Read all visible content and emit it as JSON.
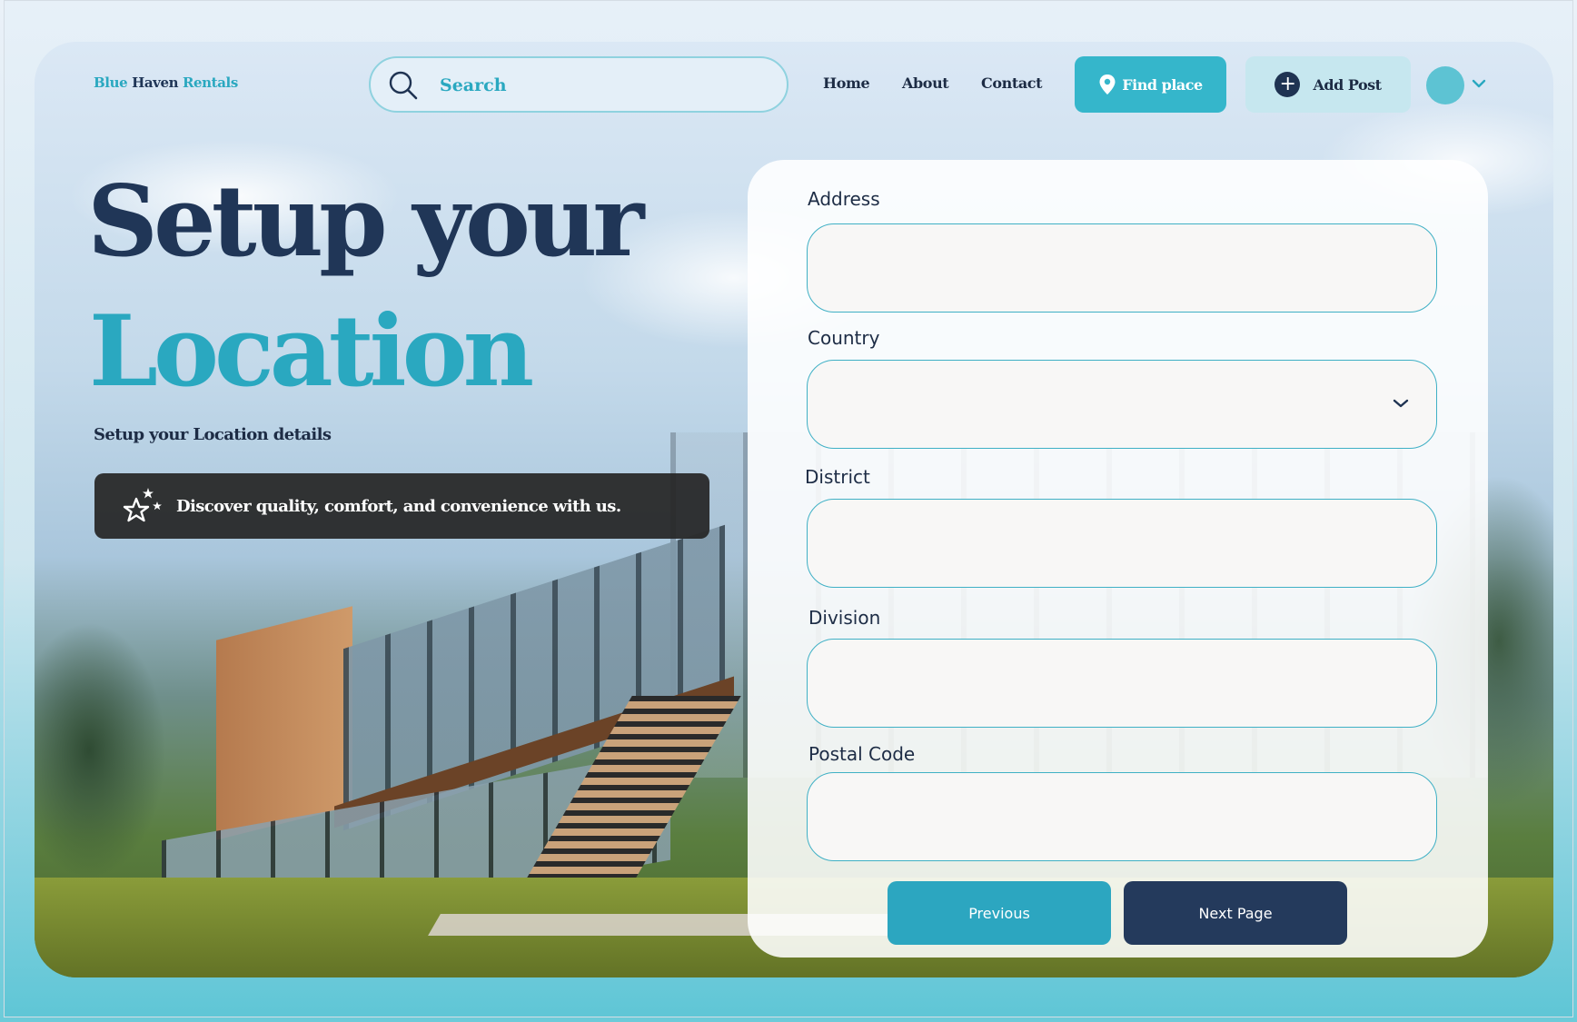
{
  "brand": {
    "part1": "Blue",
    "part2": "Haven",
    "part3": "Rentals"
  },
  "search": {
    "placeholder": "Search",
    "icon": "search-icon"
  },
  "nav": {
    "items": [
      "Home",
      "About",
      "Contact"
    ]
  },
  "actions": {
    "find_label": "Find place",
    "find_icon": "map-pin-icon",
    "add_label": "Add Post",
    "add_icon": "plus-icon"
  },
  "hero": {
    "title_line1": "Setup your",
    "title_line2": "Location",
    "subtitle": "Setup your Location details",
    "tagline": "Discover quality, comfort, and convenience with us.",
    "tagline_icon": "stars-icon"
  },
  "form": {
    "fields": [
      {
        "label": "Address",
        "value": ""
      },
      {
        "label": "Country",
        "value": ""
      },
      {
        "label": "District",
        "value": ""
      },
      {
        "label": "Division",
        "value": ""
      },
      {
        "label": "Postal Code",
        "value": ""
      }
    ],
    "previous_label": "Previous",
    "next_label": "Next Page"
  },
  "colors": {
    "accent": "#2aa8c0",
    "navy": "#203657",
    "dark_button": "#243a5c"
  }
}
